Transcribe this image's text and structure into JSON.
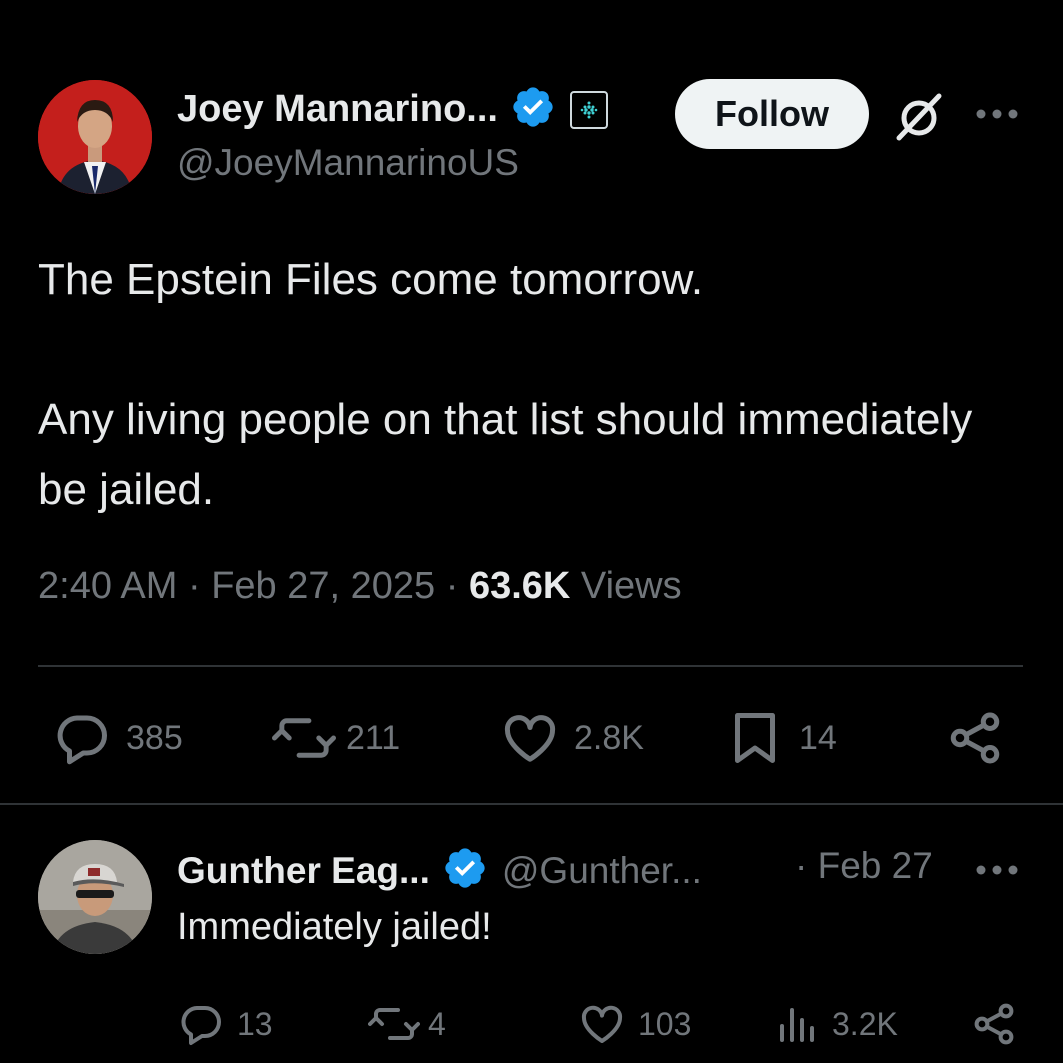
{
  "tweet": {
    "author": {
      "display_name": "Joey Mannarino...",
      "handle": "@JoeyMannarinoUS",
      "verified": true,
      "avatar_icon": "person-portrait-red-background"
    },
    "follow_label": "Follow",
    "text_paragraphs": [
      "The Epstein Files come tomorrow.",
      "Any living people on that list should immediately be jailed."
    ],
    "time": "2:40 AM",
    "separator": "·",
    "date": "Feb 27, 2025",
    "views_count": "63.6K",
    "views_label": "Views",
    "stats": {
      "replies": "385",
      "reposts": "211",
      "likes": "2.8K",
      "bookmarks": "14"
    }
  },
  "reply": {
    "author": {
      "display_name": "Gunther Eag...",
      "handle": "@Gunther...",
      "verified": true,
      "avatar_icon": "person-portrait-cap-sunglasses"
    },
    "date": "· Feb 27",
    "text": "Immediately jailed!",
    "stats": {
      "replies": "13",
      "reposts": "4",
      "likes": "103",
      "views": "3.2K"
    }
  },
  "colors": {
    "background": "#000000",
    "primary_text": "#e7e9ea",
    "secondary_text": "#71767b",
    "verified_blue": "#1d9bf0",
    "divider": "#2f3336"
  }
}
